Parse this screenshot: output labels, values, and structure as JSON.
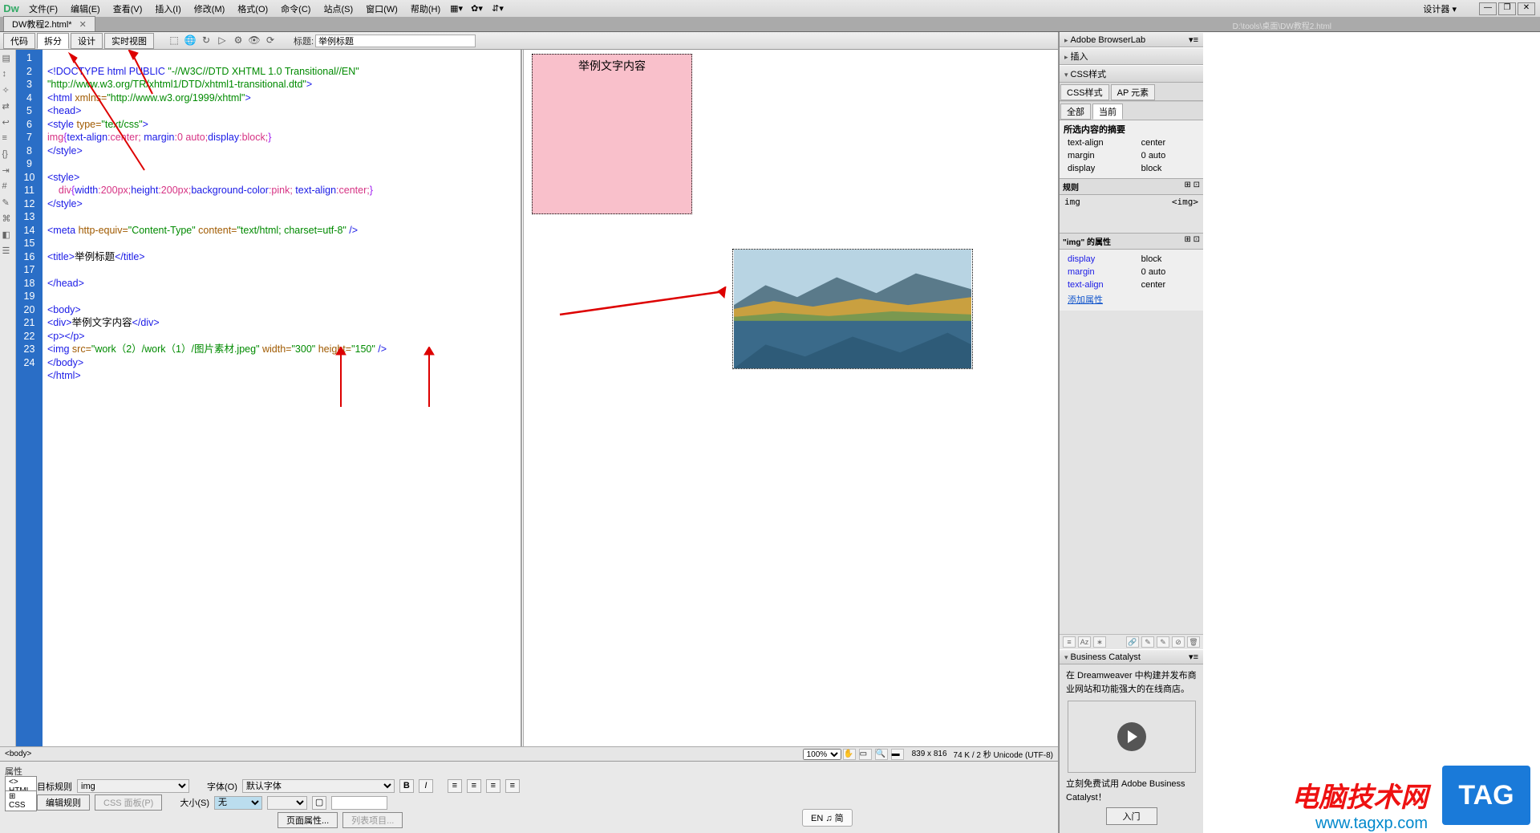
{
  "menu": {
    "logo": "Dw",
    "items": [
      "文件(F)",
      "编辑(E)",
      "查看(V)",
      "插入(I)",
      "修改(M)",
      "格式(O)",
      "命令(C)",
      "站点(S)",
      "窗口(W)",
      "帮助(H)"
    ],
    "designer": "设计器",
    "winmin": "—",
    "winmax": "❐",
    "winclose": "✕"
  },
  "doc": {
    "tab": "DW教程2.html*",
    "path": "D:\\tools\\桌面\\DW教程2.html",
    "view_code": "代码",
    "view_split": "拆分",
    "view_design": "设计",
    "view_live": "实时视图",
    "title_label": "标题:",
    "title_value": "举例标题"
  },
  "code": {
    "lines": [
      "1",
      "2",
      "3",
      "4",
      "5",
      "6",
      "7",
      "8",
      "9",
      "10",
      "11",
      "12",
      "13",
      "14",
      "15",
      "16",
      "17",
      "18",
      "19",
      "20",
      "21",
      "22",
      "23",
      "24"
    ],
    "l1a": "<!DOCTYPE html PUBLIC ",
    "l1b": "\"-//W3C//DTD XHTML 1.0 Transitional//EN\"",
    "l1c": "\"http://www.w3.org/TR/xhtml1/DTD/xhtml1-transitional.dtd\"",
    "l1d": ">",
    "l2a": "<html ",
    "l2b": "xmlns=",
    "l2c": "\"http://www.w3.org/1999/xhtml\"",
    "l2d": ">",
    "l3": "<head>",
    "l4a": "<style ",
    "l4b": "type=",
    "l4c": "\"text/css\"",
    "l4d": ">",
    "l5a": "img",
    "l5b": "{",
    "l5c": "text-align",
    "l5d": ":center; ",
    "l5e": "margin",
    "l5f": ":0 auto;",
    "l5g": "display",
    "l5h": ":block;",
    "l5i": "}",
    "l6": "</style>",
    "l8": "<style>",
    "l9a": "    div",
    "l9b": "{",
    "l9c": "width",
    "l9d": ":200px;",
    "l9e": "height",
    "l9f": ":200px;",
    "l9g": "background-color",
    "l9h": ":pink; ",
    "l9i": "text-align",
    "l9j": ":center;",
    "l9k": "}",
    "l10": "</style>",
    "l12a": "<meta ",
    "l12b": "http-equiv=",
    "l12c": "\"Content-Type\"",
    "l12d": " content=",
    "l12e": "\"text/html; charset=utf-8\"",
    "l12f": " />",
    "l14a": "<title>",
    "l14b": "举例标题",
    "l14c": "</title>",
    "l16": "</head>",
    "l18": "<body>",
    "l19a": "<div>",
    "l19b": "举例文字内容",
    "l19c": "</div>",
    "l20": "<p></p>",
    "l21a": "<img ",
    "l21b": "src=",
    "l21c": "\"work（2）/work（1）/图片素材.jpeg\"",
    "l21d": " width=",
    "l21e": "\"300\"",
    "l21f": " height=",
    "l21g": "\"150\"",
    "l21h": " />",
    "l22": "</body>",
    "l23": "</html>"
  },
  "preview": {
    "divtext": "举例文字内容"
  },
  "status": {
    "tag": "<body>",
    "zoom": "100%",
    "dims": "839 x 816",
    "info": "74 K / 2 秒 Unicode (UTF-8)"
  },
  "props": {
    "header": "属性",
    "mode_html": "<> HTML",
    "mode_css": "⊞ CSS",
    "target_rule_lbl": "目标规则",
    "target_rule_val": "img",
    "edit_rule": "编辑规则",
    "css_panel": "CSS 面板(P)",
    "font_lbl": "字体(O)",
    "font_val": "默认字体",
    "size_lbl": "大小(S)",
    "size_val": "无",
    "page_props": "页面属性...",
    "list_items": "列表项目..."
  },
  "panels": {
    "browserlab": "Adobe BrowserLab",
    "insert": "插入",
    "css_styles": "CSS样式",
    "ap_elements": "AP 元素",
    "tab_all": "全部",
    "tab_current": "当前",
    "summary_hdr": "所选内容的摘要",
    "summary": [
      {
        "k": "text-align",
        "v": "center"
      },
      {
        "k": "margin",
        "v": "0 auto"
      },
      {
        "k": "display",
        "v": "block"
      }
    ],
    "rules_hdr": "规则",
    "rule_sel": "img",
    "rule_tag": "<img>",
    "props_hdr": "\"img\" 的属性",
    "img_props": [
      {
        "k": "display",
        "v": "block"
      },
      {
        "k": "margin",
        "v": "0 auto"
      },
      {
        "k": "text-align",
        "v": "center"
      }
    ],
    "add_prop": "添加属性",
    "bcat_hdr": "Business Catalyst",
    "bcat_txt": "在 Dreamweaver 中构建并发布商业网站和功能强大的在线商店。",
    "bcat_try": "立刻免费试用 Adobe Business Catalyst！",
    "bcat_btn": "入门"
  },
  "ime": "EN ♫ 简",
  "watermark": {
    "t1": "电脑技术网",
    "t2": "www.tagxp.com",
    "tag": "TAG"
  }
}
